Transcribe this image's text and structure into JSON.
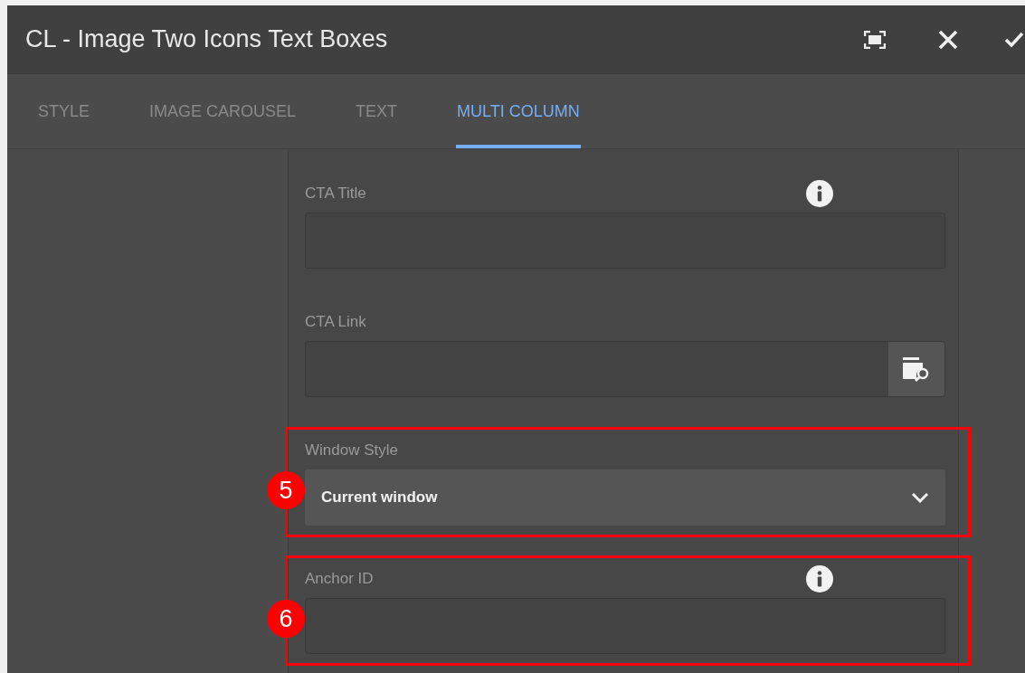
{
  "dialog": {
    "title": "CL - Image Two Icons Text Boxes"
  },
  "tabs": [
    {
      "label": "STYLE",
      "selected": false
    },
    {
      "label": "IMAGE CAROUSEL",
      "selected": false
    },
    {
      "label": "TEXT",
      "selected": false
    },
    {
      "label": "MULTI COLUMN",
      "selected": true
    }
  ],
  "fields": [
    {
      "kind": "text",
      "label": "CTA Title",
      "info": true
    },
    {
      "kind": "path",
      "label": "CTA Link",
      "info": false
    },
    {
      "kind": "select",
      "label": "Window Style",
      "info": false,
      "value": "Current window",
      "callout": "5"
    },
    {
      "kind": "text",
      "label": "Anchor ID",
      "info": true,
      "callout": "6"
    }
  ]
}
